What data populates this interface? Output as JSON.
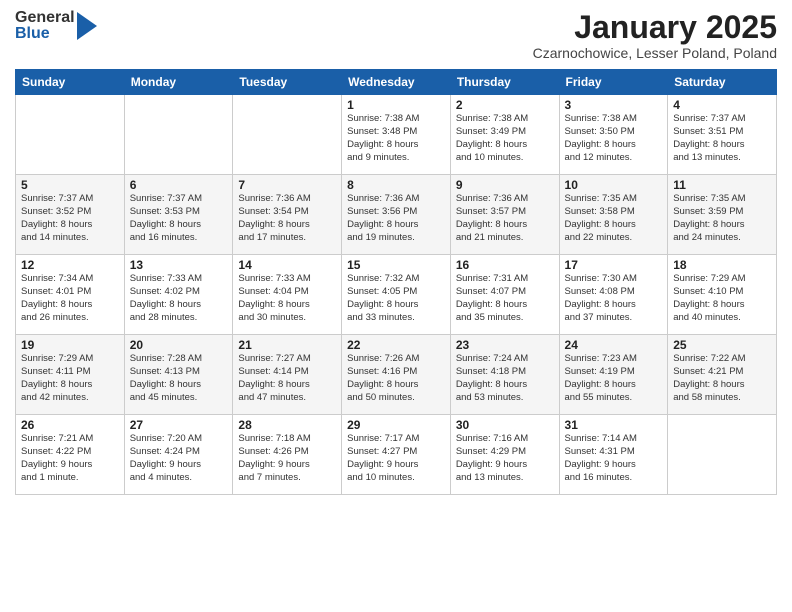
{
  "logo": {
    "general": "General",
    "blue": "Blue"
  },
  "title": "January 2025",
  "location": "Czarnochowice, Lesser Poland, Poland",
  "days_of_week": [
    "Sunday",
    "Monday",
    "Tuesday",
    "Wednesday",
    "Thursday",
    "Friday",
    "Saturday"
  ],
  "weeks": [
    [
      {
        "day": "",
        "info": ""
      },
      {
        "day": "",
        "info": ""
      },
      {
        "day": "",
        "info": ""
      },
      {
        "day": "1",
        "info": "Sunrise: 7:38 AM\nSunset: 3:48 PM\nDaylight: 8 hours\nand 9 minutes."
      },
      {
        "day": "2",
        "info": "Sunrise: 7:38 AM\nSunset: 3:49 PM\nDaylight: 8 hours\nand 10 minutes."
      },
      {
        "day": "3",
        "info": "Sunrise: 7:38 AM\nSunset: 3:50 PM\nDaylight: 8 hours\nand 12 minutes."
      },
      {
        "day": "4",
        "info": "Sunrise: 7:37 AM\nSunset: 3:51 PM\nDaylight: 8 hours\nand 13 minutes."
      }
    ],
    [
      {
        "day": "5",
        "info": "Sunrise: 7:37 AM\nSunset: 3:52 PM\nDaylight: 8 hours\nand 14 minutes."
      },
      {
        "day": "6",
        "info": "Sunrise: 7:37 AM\nSunset: 3:53 PM\nDaylight: 8 hours\nand 16 minutes."
      },
      {
        "day": "7",
        "info": "Sunrise: 7:36 AM\nSunset: 3:54 PM\nDaylight: 8 hours\nand 17 minutes."
      },
      {
        "day": "8",
        "info": "Sunrise: 7:36 AM\nSunset: 3:56 PM\nDaylight: 8 hours\nand 19 minutes."
      },
      {
        "day": "9",
        "info": "Sunrise: 7:36 AM\nSunset: 3:57 PM\nDaylight: 8 hours\nand 21 minutes."
      },
      {
        "day": "10",
        "info": "Sunrise: 7:35 AM\nSunset: 3:58 PM\nDaylight: 8 hours\nand 22 minutes."
      },
      {
        "day": "11",
        "info": "Sunrise: 7:35 AM\nSunset: 3:59 PM\nDaylight: 8 hours\nand 24 minutes."
      }
    ],
    [
      {
        "day": "12",
        "info": "Sunrise: 7:34 AM\nSunset: 4:01 PM\nDaylight: 8 hours\nand 26 minutes."
      },
      {
        "day": "13",
        "info": "Sunrise: 7:33 AM\nSunset: 4:02 PM\nDaylight: 8 hours\nand 28 minutes."
      },
      {
        "day": "14",
        "info": "Sunrise: 7:33 AM\nSunset: 4:04 PM\nDaylight: 8 hours\nand 30 minutes."
      },
      {
        "day": "15",
        "info": "Sunrise: 7:32 AM\nSunset: 4:05 PM\nDaylight: 8 hours\nand 33 minutes."
      },
      {
        "day": "16",
        "info": "Sunrise: 7:31 AM\nSunset: 4:07 PM\nDaylight: 8 hours\nand 35 minutes."
      },
      {
        "day": "17",
        "info": "Sunrise: 7:30 AM\nSunset: 4:08 PM\nDaylight: 8 hours\nand 37 minutes."
      },
      {
        "day": "18",
        "info": "Sunrise: 7:29 AM\nSunset: 4:10 PM\nDaylight: 8 hours\nand 40 minutes."
      }
    ],
    [
      {
        "day": "19",
        "info": "Sunrise: 7:29 AM\nSunset: 4:11 PM\nDaylight: 8 hours\nand 42 minutes."
      },
      {
        "day": "20",
        "info": "Sunrise: 7:28 AM\nSunset: 4:13 PM\nDaylight: 8 hours\nand 45 minutes."
      },
      {
        "day": "21",
        "info": "Sunrise: 7:27 AM\nSunset: 4:14 PM\nDaylight: 8 hours\nand 47 minutes."
      },
      {
        "day": "22",
        "info": "Sunrise: 7:26 AM\nSunset: 4:16 PM\nDaylight: 8 hours\nand 50 minutes."
      },
      {
        "day": "23",
        "info": "Sunrise: 7:24 AM\nSunset: 4:18 PM\nDaylight: 8 hours\nand 53 minutes."
      },
      {
        "day": "24",
        "info": "Sunrise: 7:23 AM\nSunset: 4:19 PM\nDaylight: 8 hours\nand 55 minutes."
      },
      {
        "day": "25",
        "info": "Sunrise: 7:22 AM\nSunset: 4:21 PM\nDaylight: 8 hours\nand 58 minutes."
      }
    ],
    [
      {
        "day": "26",
        "info": "Sunrise: 7:21 AM\nSunset: 4:22 PM\nDaylight: 9 hours\nand 1 minute."
      },
      {
        "day": "27",
        "info": "Sunrise: 7:20 AM\nSunset: 4:24 PM\nDaylight: 9 hours\nand 4 minutes."
      },
      {
        "day": "28",
        "info": "Sunrise: 7:18 AM\nSunset: 4:26 PM\nDaylight: 9 hours\nand 7 minutes."
      },
      {
        "day": "29",
        "info": "Sunrise: 7:17 AM\nSunset: 4:27 PM\nDaylight: 9 hours\nand 10 minutes."
      },
      {
        "day": "30",
        "info": "Sunrise: 7:16 AM\nSunset: 4:29 PM\nDaylight: 9 hours\nand 13 minutes."
      },
      {
        "day": "31",
        "info": "Sunrise: 7:14 AM\nSunset: 4:31 PM\nDaylight: 9 hours\nand 16 minutes."
      },
      {
        "day": "",
        "info": ""
      }
    ]
  ]
}
